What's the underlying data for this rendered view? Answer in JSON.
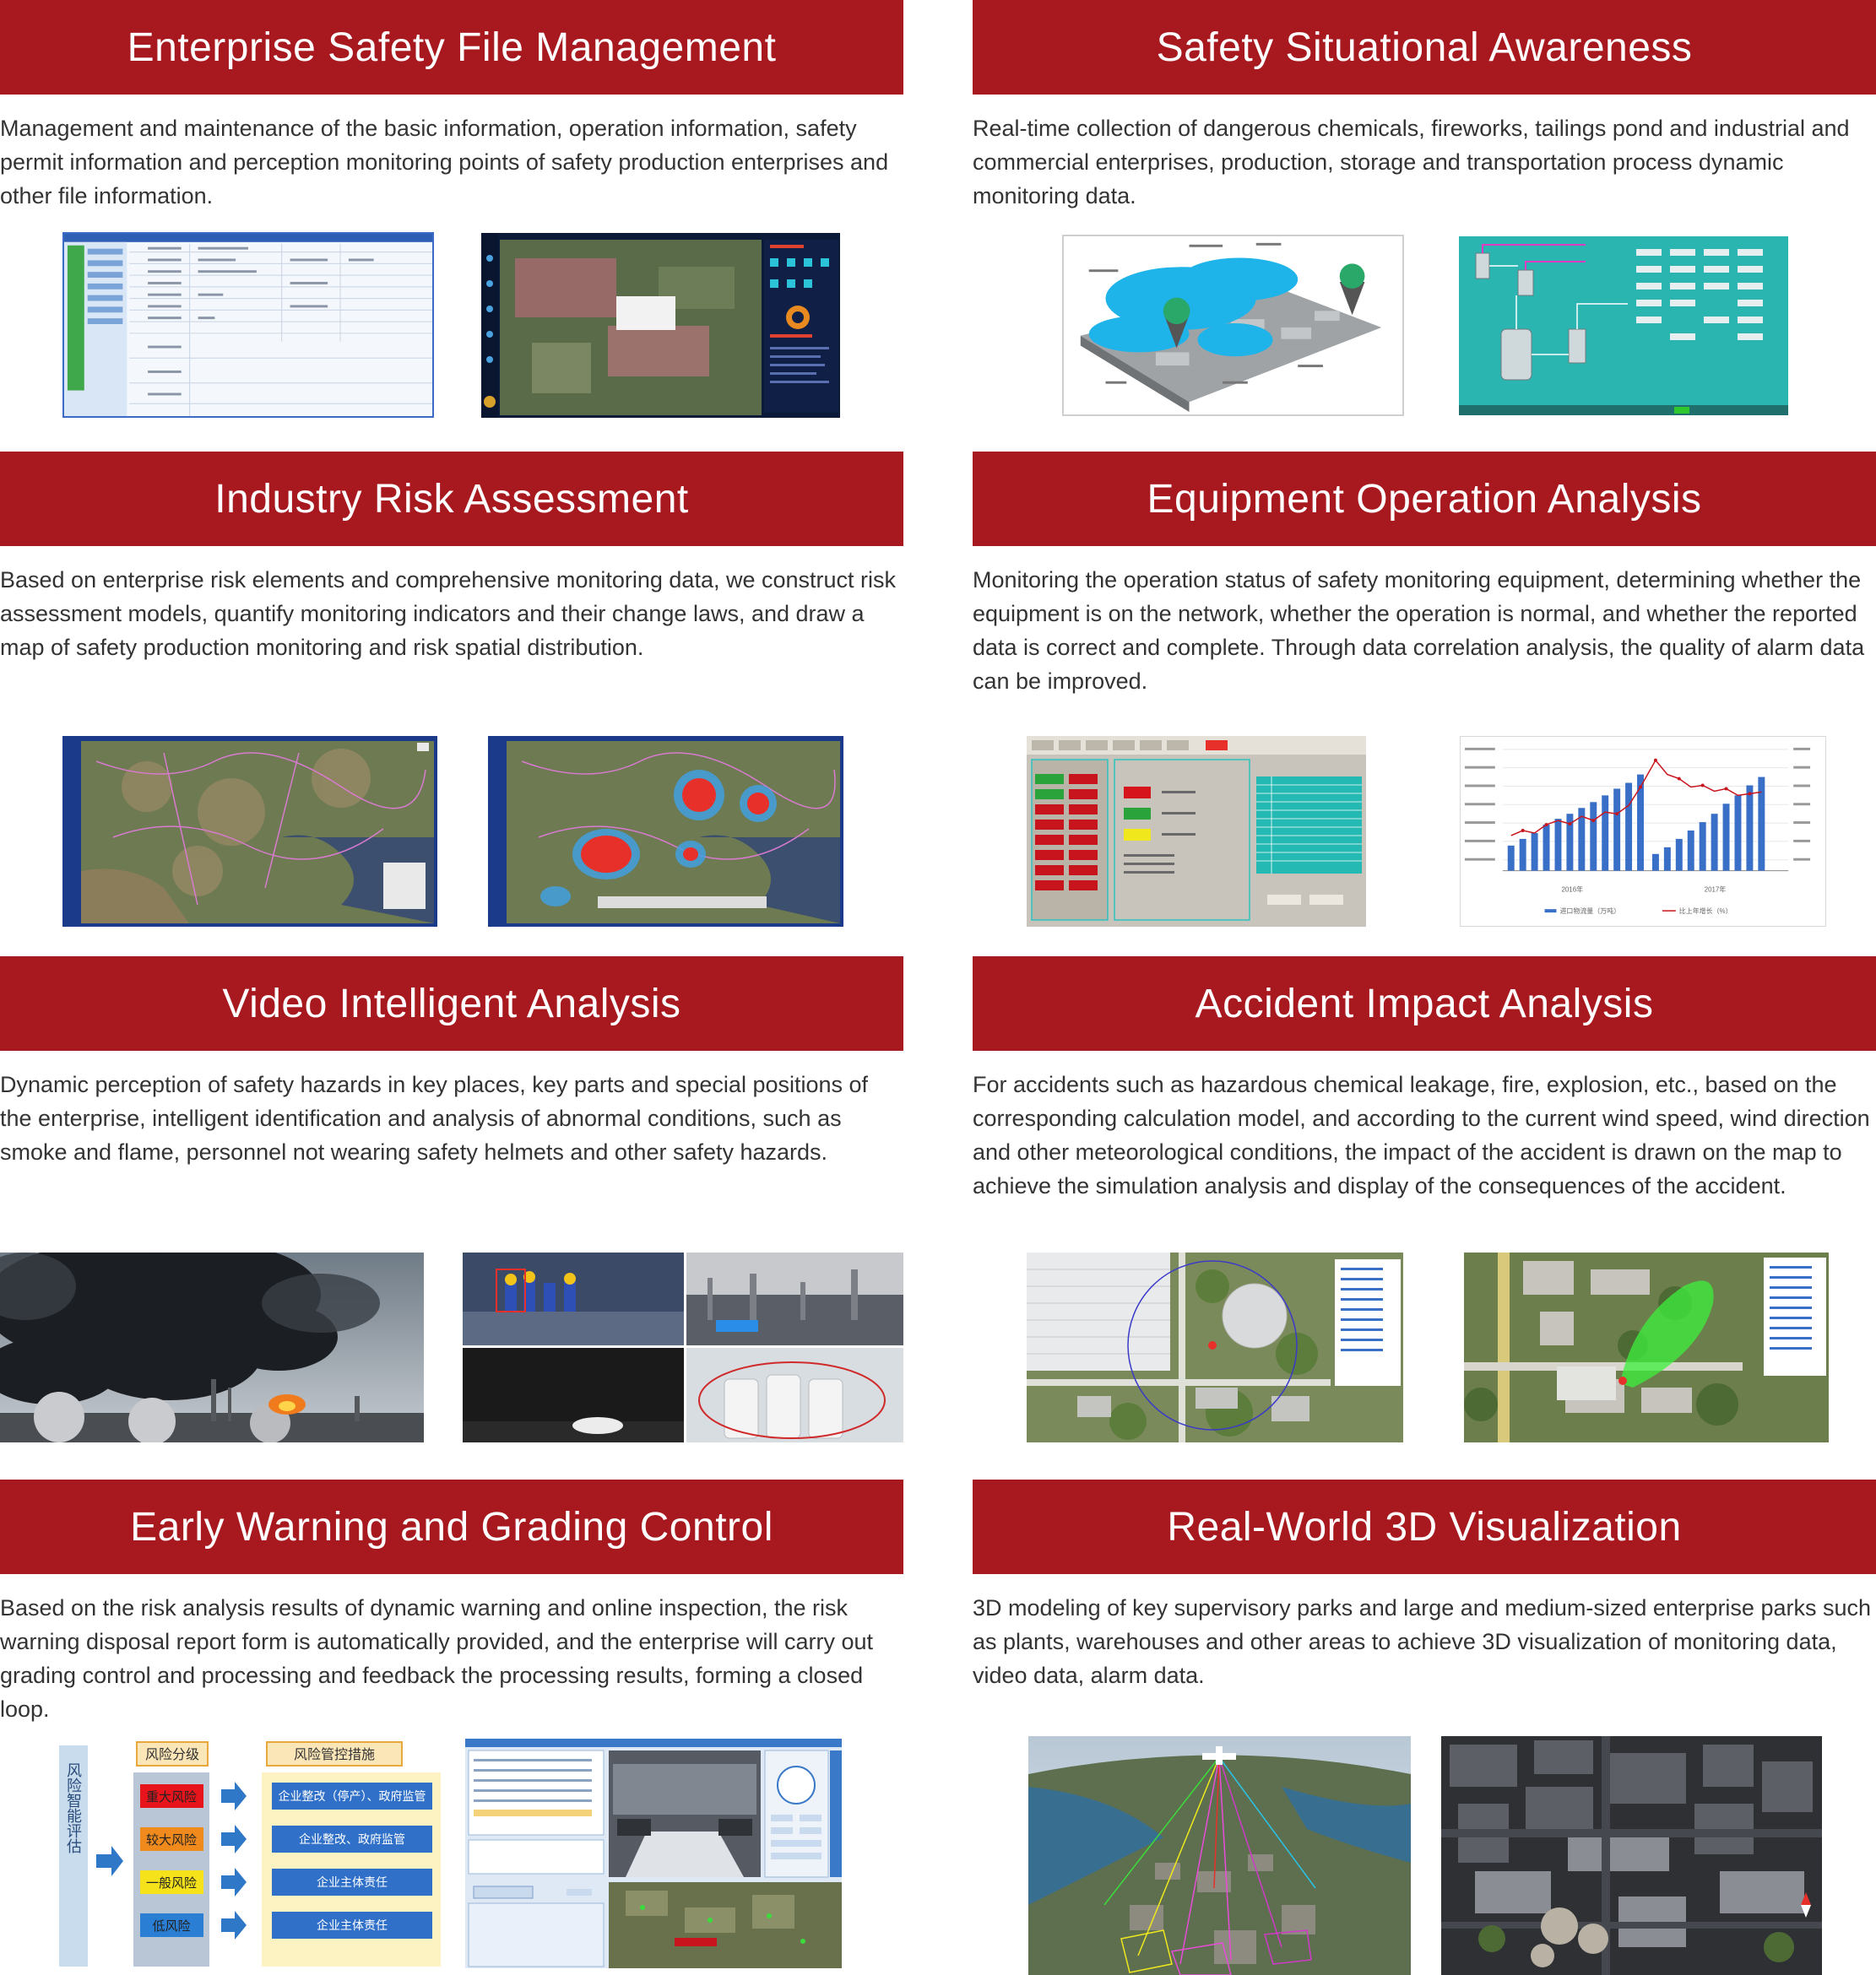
{
  "sections": [
    {
      "title": "Enterprise Safety File Management",
      "description": "Management and maintenance of the basic information, operation information, safety permit information and perception monitoring points of safety production enterprises and other file information."
    },
    {
      "title": "Safety Situational Awareness",
      "description": "Real-time collection of dangerous chemicals, fireworks, tailings pond and industrial and commercial enterprises, production, storage and transportation process dynamic monitoring data."
    },
    {
      "title": "Industry Risk Assessment",
      "description": "Based on enterprise risk elements and comprehensive monitoring data, we construct risk assessment models, quantify monitoring indicators and their change laws, and draw a map of safety production monitoring and risk spatial distribution."
    },
    {
      "title": "Equipment Operation Analysis",
      "description": "Monitoring the operation status of safety monitoring equipment, determining whether the equipment is on the network, whether the operation is normal, and whether the reported data is correct and complete. Through data correlation analysis, the quality of alarm data can be improved."
    },
    {
      "title": "Video Intelligent Analysis",
      "description": "Dynamic perception of safety hazards in key places, key parts and special positions of the enterprise, intelligent identification and analysis of abnormal conditions, such as smoke and flame, personnel not wearing safety helmets and other safety hazards."
    },
    {
      "title": "Accident Impact Analysis",
      "description": "For accidents such as hazardous chemical leakage, fire, explosion, etc., based on the corresponding calculation model, and according to the current wind speed, wind direction and other meteorological conditions, the impact of the accident is drawn on the map to achieve the simulation analysis and display of the consequences of the accident."
    },
    {
      "title": "Early Warning and Grading Control",
      "description": "Based on the risk analysis results of dynamic warning and online inspection, the risk warning disposal report form is automatically provided, and the enterprise will carry out grading control and processing and feedback the processing results, forming a closed loop."
    },
    {
      "title": "Real-World 3D Visualization",
      "description": "3D modeling of key supervisory parks and large and medium-sized enterprise parks such as plants, warehouses and other areas to achieve 3D visualization of monitoring data, video data, alarm data."
    }
  ],
  "risk_diagram": {
    "left_label": "风险智能评估",
    "grading_header": "风险分级",
    "measures_header": "风险管控措施",
    "levels": [
      "重大风险",
      "较大风险",
      "一般风险",
      "低风险"
    ],
    "measures": [
      "企业整改（停产）、政府监管",
      "企业整改、政府监管",
      "企业主体责任",
      "企业主体责任"
    ],
    "level_colors": [
      "#e8141b",
      "#f08a1c",
      "#f5e21a",
      "#2a7fd4"
    ]
  },
  "chart_screenshot": {
    "year_labels": [
      "2016年",
      "2017年"
    ],
    "legend": [
      "进口物流量（万吨）",
      "比上年增长（%）"
    ]
  }
}
